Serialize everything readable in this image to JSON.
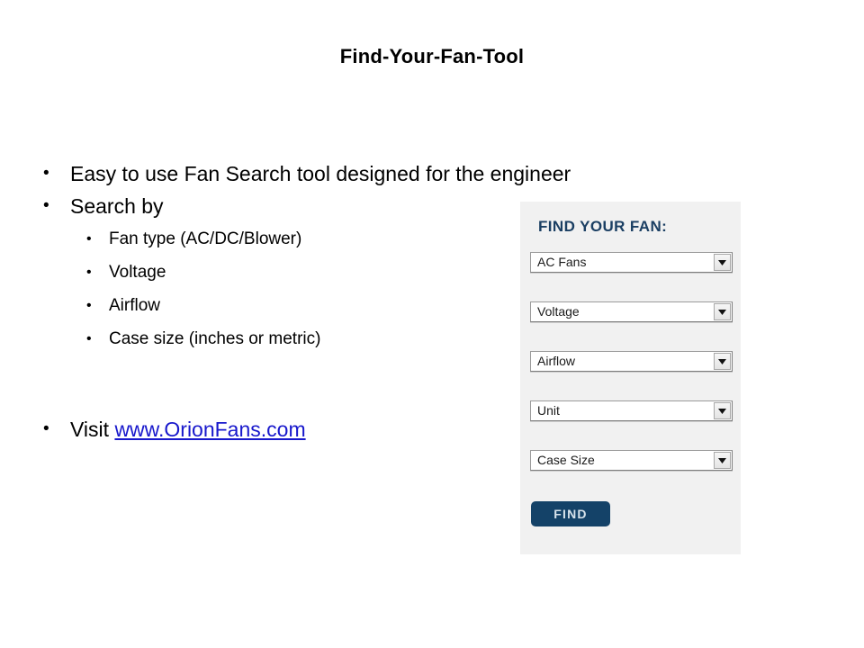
{
  "slide": {
    "title": "Find-Your-Fan-Tool"
  },
  "bullets": {
    "level1_a": "Easy to use Fan Search tool designed for the engineer",
    "level1_b": "Search by",
    "sub": [
      "Fan type (AC/DC/Blower)",
      "Voltage",
      "Airflow",
      "Case size (inches or metric)"
    ],
    "visit_prefix": "Visit ",
    "visit_link": "www.OrionFans.com",
    "glyph_level1": "•",
    "glyph_level2": "•"
  },
  "fan_panel": {
    "title": "FIND YOUR FAN:",
    "selects": [
      {
        "value": "AC Fans"
      },
      {
        "value": "Voltage"
      },
      {
        "value": "Airflow"
      },
      {
        "value": "Unit"
      },
      {
        "value": "Case Size"
      }
    ],
    "find_button_label": "FIND",
    "colors": {
      "panel_background": "#f1f1f1",
      "heading": "#1b3f63",
      "button": "#144268",
      "button_text": "#d7e3ec",
      "link": "#1818cc"
    }
  }
}
